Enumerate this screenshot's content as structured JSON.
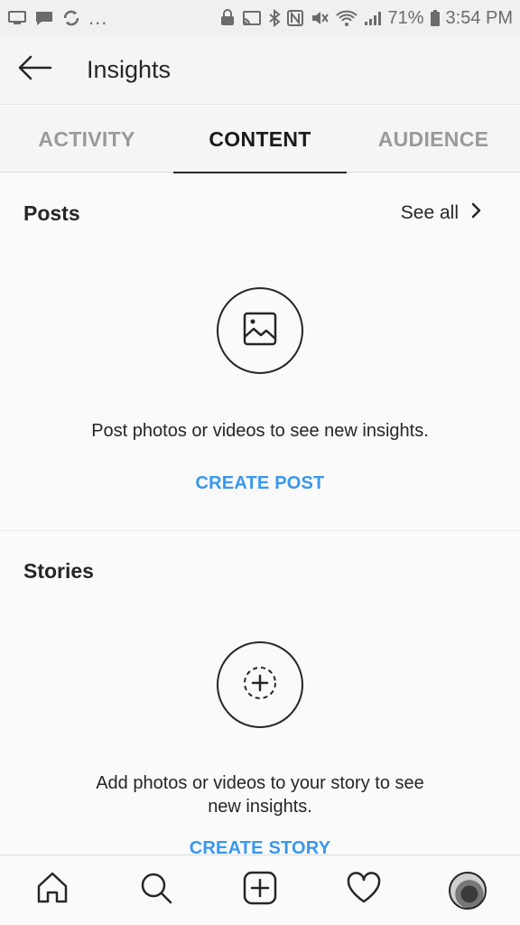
{
  "status_bar": {
    "more_indicator": "...",
    "battery_percent": "71%",
    "time": "3:54 PM"
  },
  "header": {
    "title": "Insights"
  },
  "tabs": [
    {
      "label": "ACTIVITY",
      "active": false
    },
    {
      "label": "CONTENT",
      "active": true
    },
    {
      "label": "AUDIENCE",
      "active": false
    }
  ],
  "posts": {
    "title": "Posts",
    "see_all": "See all",
    "empty_text": "Post photos or videos to see new insights.",
    "cta": "CREATE POST"
  },
  "stories": {
    "title": "Stories",
    "empty_text_line1": "Add photos or videos to your story to see",
    "empty_text_line2": "new insights.",
    "cta": "CREATE STORY"
  },
  "bottom_nav": {
    "items": [
      "home-icon",
      "search-icon",
      "new-post-icon",
      "activity-heart-icon",
      "profile-avatar"
    ]
  },
  "colors": {
    "accent": "#3897f0",
    "text": "#262626",
    "inactive_tab": "#9a9a9a"
  }
}
